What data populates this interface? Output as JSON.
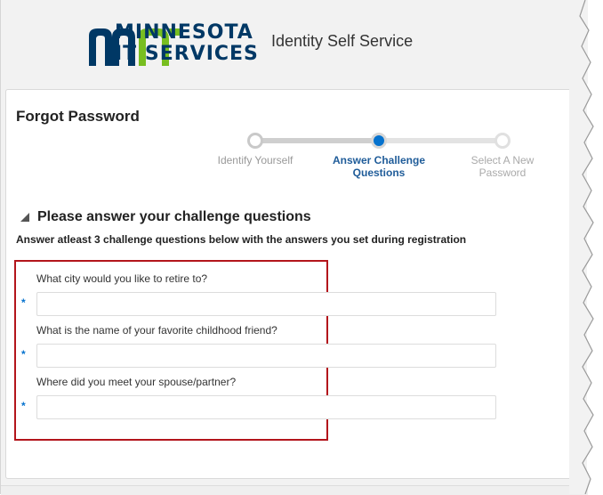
{
  "header": {
    "logo_line1": "MINNESOTA",
    "logo_line2": "IT SERVICES",
    "app_title": "Identity Self Service"
  },
  "colors": {
    "brand_navy": "#003865",
    "brand_green": "#78be20",
    "accent_blue": "#0572ce",
    "highlight_red": "#b3151b"
  },
  "panel": {
    "title": "Forgot Password"
  },
  "train": {
    "steps": [
      {
        "label_line1": "Identify Yourself",
        "label_line2": "",
        "state": "done"
      },
      {
        "label_line1": "Answer Challenge",
        "label_line2": "Questions",
        "state": "current"
      },
      {
        "label_line1": "Select A New",
        "label_line2": "Password",
        "state": "todo"
      }
    ]
  },
  "section": {
    "title": "Please answer your challenge questions",
    "instructions": "Answer atleast 3 challenge questions below with the answers you set during registration"
  },
  "questions": [
    {
      "label": "What city would you like to retire to?",
      "required_marker": "*",
      "value": ""
    },
    {
      "label": "What is the name of your favorite childhood friend?",
      "required_marker": "*",
      "value": ""
    },
    {
      "label": "Where did you meet your spouse/partner?",
      "required_marker": "*",
      "value": ""
    }
  ]
}
